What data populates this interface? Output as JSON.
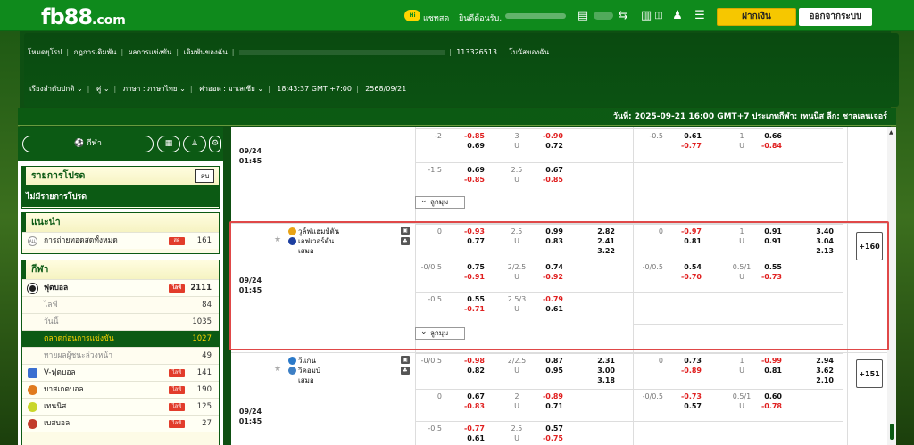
{
  "header": {
    "logo_main": "fb88",
    "logo_domain": ".com",
    "chat_badge": "Hi",
    "chat_label": "แชทสด",
    "welcome_label": "ยินดีต้อนรับ,",
    "deposit_label": "ฝากเงิน",
    "logout_label": "ออกจากระบบ"
  },
  "nav": {
    "links": [
      "โหมดยุโรป",
      "กฎการเดิมพัน",
      "ผลการแข่งขัน",
      "เดิมพันของฉัน"
    ],
    "account_id": "113326513",
    "bonus_label": "โบนัสของฉัน",
    "order_label": "เรียงลำดับปกติ",
    "pair_label": "คู่",
    "language_label": "ภาษา : ภาษาไทย",
    "odds_label": "ค่าออด : มาเลเซีย",
    "clock": "18:43:37 GMT +7:00",
    "date": "2568/09/21"
  },
  "date_bar": "วันที่: 2025-09-21 16:00 GMT+7 ประเภทกีฬา: เทนนิส ลีก: ชาลเลนเจอร์",
  "sidebar": {
    "sport_button": "กีฬา",
    "favorites_title": "รายการโปรด",
    "delete_label": "ลบ",
    "no_favorites": "ไม่มีรายการโปรด",
    "recommend_title": "แนะนำ",
    "live_all_badge": "ALL",
    "live_all_label": "การถ่ายทอดสดทั้งหมด",
    "live_tag": "สด",
    "live_all_count": "161",
    "sports_title": "กีฬา",
    "live_badge": "ไลฟ์",
    "football": {
      "label": "ฟุตบอล",
      "count": "2111"
    },
    "sub_items": [
      {
        "label": "ไลฟ์",
        "count": "84"
      },
      {
        "label": "วันนี้",
        "count": "1035"
      },
      {
        "label": "ตลาดก่อนการแข่งขัน",
        "count": "1027"
      },
      {
        "label": "ทายผลผู้ชนะล่วงหน้า",
        "count": "49"
      }
    ],
    "sports": [
      {
        "label": "V-ฟุตบอล",
        "count": "141",
        "color": "#3b6fd0"
      },
      {
        "label": "บาสเกตบอล",
        "count": "190",
        "color": "#e07b20"
      },
      {
        "label": "เทนนิส",
        "count": "125",
        "color": "#c9d62a"
      },
      {
        "label": "เบสบอล",
        "count": "27",
        "color": "#c23b2b"
      }
    ]
  },
  "events": {
    "more_label": "ลูกมุม",
    "top_partial": {
      "time_date": "09/24",
      "time_clock": "01:45",
      "rows": [
        {
          "hdp": "-2",
          "h1": "-0.85",
          "h2": "0.69",
          "ou": "3",
          "u": "U",
          "o1": "-0.90",
          "o2": "0.72",
          "hdp2": "-0.5",
          "a1": "0.61",
          "a2": "-0.77",
          "ou2": "1",
          "u2": "U",
          "b1": "0.66",
          "b2": "-0.84"
        },
        {
          "hdp": "-1.5",
          "h1": "0.69",
          "h2": "-0.85",
          "ou": "2.5",
          "u": "U",
          "o1": "0.67",
          "o2": "-0.85"
        }
      ]
    },
    "featured": {
      "time_date": "09/24",
      "time_clock": "01:45",
      "home": "วูล์ฟแฮมป์ตัน",
      "away": "เอฟเวอร์ตัน",
      "draw": "เสมอ",
      "plus_count": "+160",
      "main_row": {
        "hdp": "0",
        "h1": "-0.93",
        "h2": "0.77",
        "ou": "2.5",
        "u": "U",
        "o1": "0.99",
        "o2": "0.83",
        "x1": "2.82",
        "x2": "2.41",
        "x3": "3.22",
        "hdp2": "0",
        "a1": "-0.97",
        "a2": "0.81",
        "ou2": "1",
        "u2": "U",
        "b1": "0.91",
        "b2": "0.91",
        "y1": "3.40",
        "y2": "3.04",
        "y3": "2.13"
      },
      "row2": {
        "hdp": "-0/0.5",
        "h1": "0.75",
        "h2": "-0.91",
        "ou": "2/2.5",
        "u": "U",
        "o1": "0.74",
        "o2": "-0.92",
        "hdp2": "-0/0.5",
        "a1": "0.54",
        "a2": "-0.70",
        "ou2": "0.5/1",
        "u2": "U",
        "b1": "0.55",
        "b2": "-0.73"
      },
      "row3": {
        "hdp": "-0.5",
        "h1": "0.55",
        "h2": "-0.71",
        "ou": "2.5/3",
        "u": "U",
        "o1": "-0.79",
        "o2": "0.61"
      }
    },
    "next": {
      "time_date": "09/24",
      "time_clock": "01:45",
      "home": "วีแกน",
      "away": "วิคอมบ์",
      "draw": "เสมอ",
      "plus_count": "+151",
      "main_row": {
        "hdp": "-0/0.5",
        "h1": "-0.98",
        "h2": "0.82",
        "ou": "2/2.5",
        "u": "U",
        "o1": "0.87",
        "o2": "0.95",
        "x1": "2.31",
        "x2": "3.00",
        "x3": "3.18",
        "hdp2": "0",
        "a1": "0.73",
        "a2": "-0.89",
        "ou2": "1",
        "u2": "U",
        "b1": "-0.99",
        "b2": "0.81",
        "y1": "2.94",
        "y2": "3.62",
        "y3": "2.10"
      },
      "row2": {
        "hdp": "0",
        "h1": "0.67",
        "h2": "-0.83",
        "ou": "2",
        "u": "U",
        "o1": "-0.89",
        "o2": "0.71",
        "hdp2": "-0/0.5",
        "a1": "-0.73",
        "a2": "0.57",
        "ou2": "0.5/1",
        "u2": "U",
        "b1": "0.60",
        "b2": "-0.78"
      },
      "row3": {
        "hdp": "-0.5",
        "h1": "-0.77",
        "h2": "0.61",
        "ou": "2.5",
        "u": "U",
        "o1": "0.57",
        "o2": "-0.75"
      }
    }
  }
}
